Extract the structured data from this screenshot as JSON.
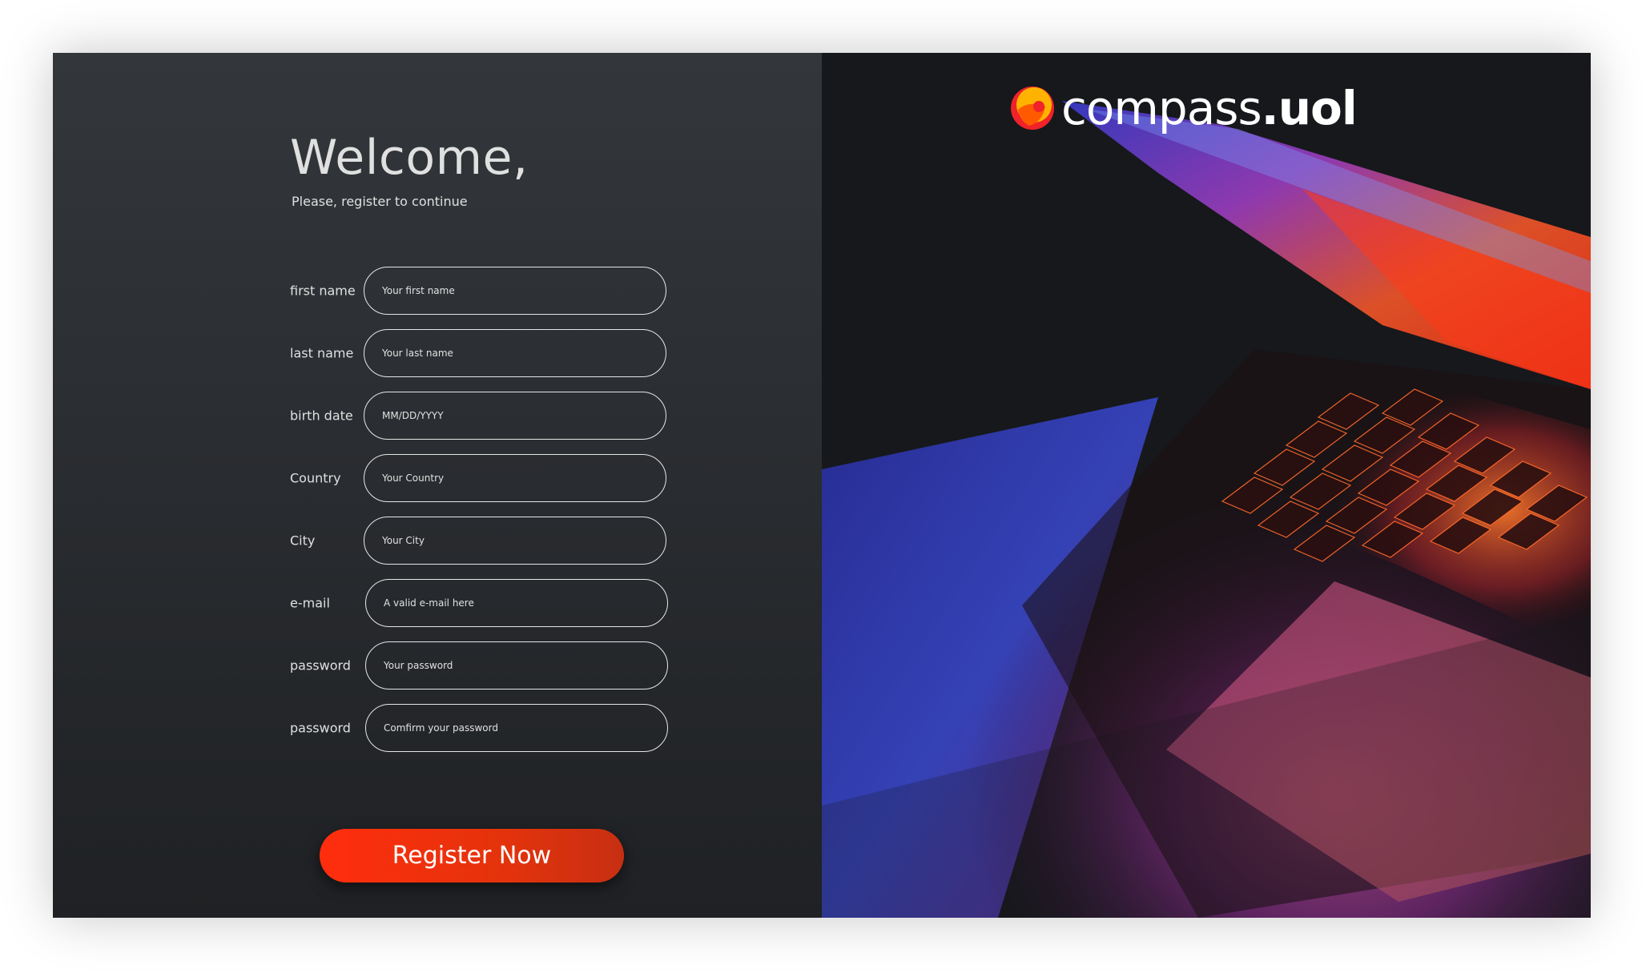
{
  "welcome": {
    "title": "Welcome,",
    "subtitle": "Please, register to continue"
  },
  "form": {
    "fields": [
      {
        "label": "first name",
        "placeholder": "Your first name"
      },
      {
        "label": "last name",
        "placeholder": "Your last name"
      },
      {
        "label": "birth date",
        "placeholder": "MM/DD/YYYY"
      },
      {
        "label": "Country",
        "placeholder": "Your Country"
      },
      {
        "label": "City",
        "placeholder": "Your City"
      },
      {
        "label": "e-mail",
        "placeholder": "A valid e-mail here"
      },
      {
        "label": "password",
        "placeholder": "Your password"
      },
      {
        "label": "password",
        "placeholder": "Comfirm your password"
      }
    ],
    "submit_label": "Register Now"
  },
  "brand": {
    "name": "compass",
    "suffix": ".uol",
    "accent": "#ff2d0d"
  },
  "icons": {
    "logo_mark": "compass-logo-icon"
  }
}
